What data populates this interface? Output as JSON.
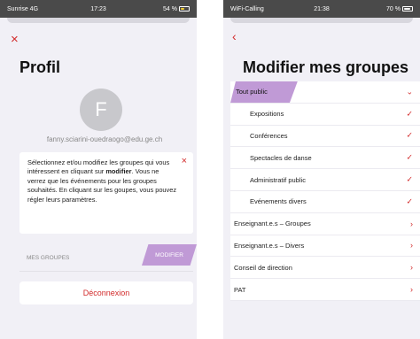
{
  "left": {
    "status": {
      "carrier": "Sunrise 4G",
      "time": "17:23",
      "battery": "54 %"
    },
    "close_glyph": "×",
    "title": "Profil",
    "avatar_letter": "F",
    "email": "fanny.sciarini-ouedraogo@edu.ge.ch",
    "info": {
      "part1": "Sélectionnez et/ou modifiez les groupes qui vous intéressent en cliquant sur ",
      "bold": "modifier",
      "part2": ". Vous ne verrez que les événements pour les groupes souhaités. En cliquant sur les goupes, vous pouvez régler leurs paramètres.",
      "close_glyph": "×"
    },
    "groups_label": "MES GROUPES",
    "modify_label": "MODIFIER",
    "logout_label": "Déconnexion"
  },
  "right": {
    "status": {
      "carrier": "WiFi-Calling",
      "time": "21:38",
      "battery": "70 %"
    },
    "back_glyph": "‹",
    "title": "Modifier mes groupes",
    "groups": [
      {
        "label": "Tout public",
        "kind": "header",
        "mark": "⌄"
      },
      {
        "label": "Expositions",
        "kind": "child",
        "mark": "✓"
      },
      {
        "label": "Conférences",
        "kind": "child",
        "mark": "✓"
      },
      {
        "label": "Spectacles de danse",
        "kind": "child",
        "mark": "✓"
      },
      {
        "label": "Administratif public",
        "kind": "child",
        "mark": "✓"
      },
      {
        "label": "Evénements divers",
        "kind": "child",
        "mark": "✓"
      },
      {
        "label": "Enseignant.e.s – Groupes",
        "kind": "group",
        "mark": "›"
      },
      {
        "label": "Enseignant.e.s – Divers",
        "kind": "group",
        "mark": "›"
      },
      {
        "label": "Conseil de direction",
        "kind": "group",
        "mark": "›"
      },
      {
        "label": "PAT",
        "kind": "group",
        "mark": "›"
      }
    ]
  },
  "colors": {
    "accent_red": "#d22a2a",
    "highlight_purple": "#c09ad6",
    "background": "#f1f0f6"
  }
}
